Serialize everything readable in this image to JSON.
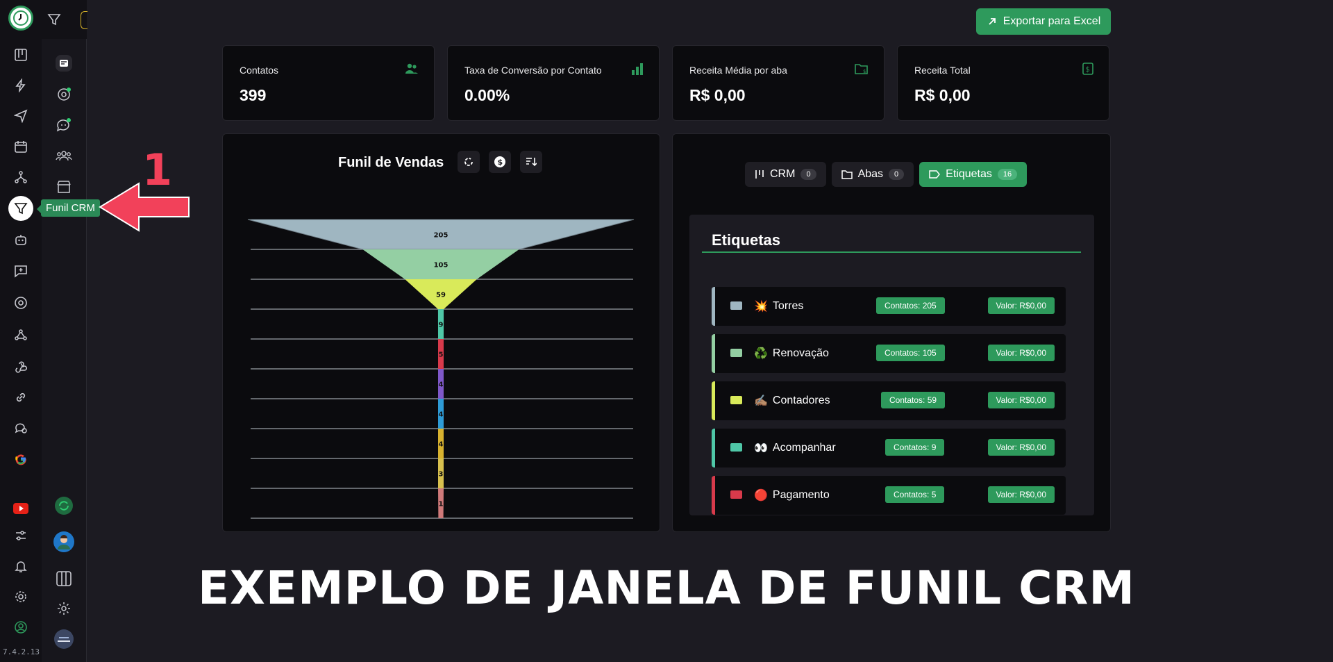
{
  "app": {
    "version": "7.4.2.13"
  },
  "tooltip": {
    "label": "Funil CRM"
  },
  "annotation": {
    "number": "1"
  },
  "header": {
    "export_label": "Exportar para Excel"
  },
  "stats": [
    {
      "label": "Contatos",
      "value": "399",
      "icon": "users-icon"
    },
    {
      "label": "Taxa de Conversão por Contato",
      "value": "0.00%",
      "icon": "bar-chart-icon"
    },
    {
      "label": "Receita Média por aba",
      "value": "R$ 0,00",
      "icon": "folder-money-icon"
    },
    {
      "label": "Receita Total",
      "value": "R$ 0,00",
      "icon": "money-icon"
    }
  ],
  "funnel": {
    "title": "Funil de Vendas",
    "chart_data": {
      "type": "funnel",
      "values": [
        205,
        105,
        59,
        9,
        5,
        4,
        4,
        4,
        3,
        1
      ],
      "colors": [
        "#9fb6c1",
        "#94cfa3",
        "#d9ea5a",
        "#4fc7a7",
        "#d83a4b",
        "#7f58c9",
        "#2e9bd6",
        "#d8b22f",
        "#d8c04e",
        "#d07a7a"
      ]
    }
  },
  "tabs": [
    {
      "label": "CRM",
      "count": "0",
      "active": false
    },
    {
      "label": "Abas",
      "count": "0",
      "active": false
    },
    {
      "label": "Etiquetas",
      "count": "16",
      "active": true
    }
  ],
  "etiquetas": {
    "title": "Etiquetas",
    "items": [
      {
        "emoji": "💥",
        "name": "Torres",
        "contatos": "Contatos: 205",
        "valor": "Valor: R$0,00",
        "color": "#9fb6c1"
      },
      {
        "emoji": "♻️",
        "name": "Renovação",
        "contatos": "Contatos: 105",
        "valor": "Valor: R$0,00",
        "color": "#94cfa3"
      },
      {
        "emoji": "✍🏽",
        "name": "Contadores",
        "contatos": "Contatos: 59",
        "valor": "Valor: R$0,00",
        "color": "#d9ea5a"
      },
      {
        "emoji": "👀",
        "name": "Acompanhar",
        "contatos": "Contatos: 9",
        "valor": "Valor: R$0,00",
        "color": "#4fc7a7"
      },
      {
        "emoji": "🔴",
        "name": "Pagamento",
        "contatos": "Contatos: 5",
        "valor": "Valor: R$0,00",
        "color": "#d83a4b"
      }
    ]
  },
  "banner": {
    "text": "EXEMPLO DE JANELA DE FUNIL CRM"
  }
}
